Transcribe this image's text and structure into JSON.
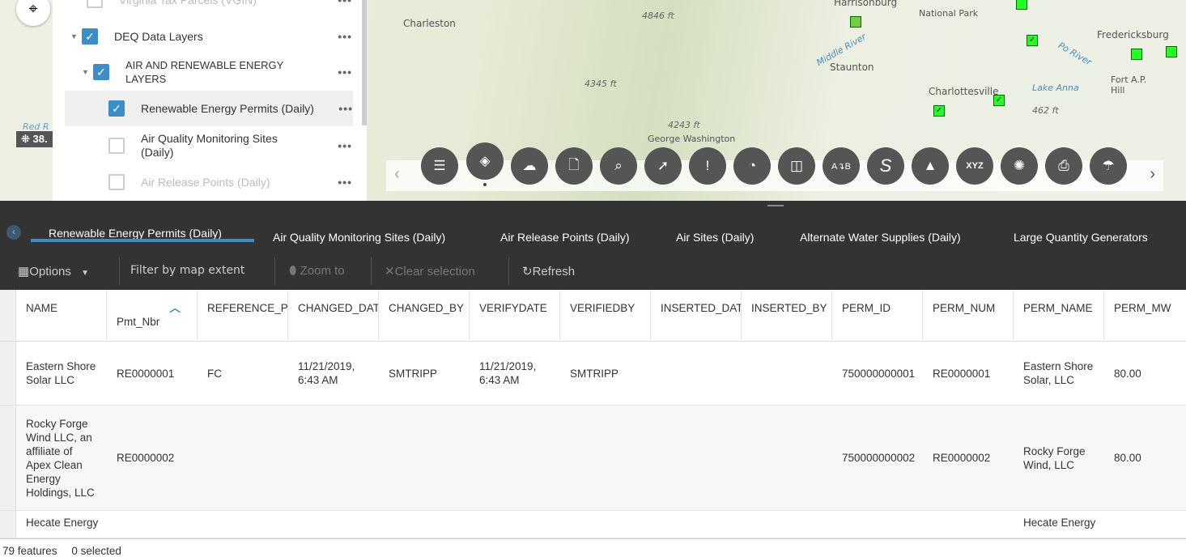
{
  "map": {
    "labels": [
      "Charleston",
      "4846 ft",
      "Harrisonburg",
      "National Park",
      "Fredericksburg",
      "Staunton",
      "4345 ft",
      "Charlottesville",
      "Lake Anna",
      "462 ft",
      "Fort A.P. Hill",
      "4243 ft",
      "George Washington",
      "Red R",
      "Middle River",
      "Po River"
    ],
    "coordinate": "38."
  },
  "layers": {
    "items": [
      {
        "label": "Virginia Tax Parcels (VGIN)",
        "checked": false
      },
      {
        "label": "DEQ Data Layers",
        "checked": true
      },
      {
        "label": "AIR AND RENEWABLE ENERGY LAYERS",
        "checked": true
      },
      {
        "label": "Renewable Energy Permits (Daily)",
        "checked": true
      },
      {
        "label": "Air Quality Monitoring Sites (Daily)",
        "checked": false
      },
      {
        "label": "Air Release Points (Daily)",
        "checked": false
      }
    ],
    "more": "•••"
  },
  "toolbar": {
    "tools": [
      "legend",
      "layer-list",
      "add-data",
      "add-file",
      "query",
      "select",
      "incident",
      "screening",
      "swipe",
      "directions",
      "draw",
      "elevation-profile",
      "coordinate-conversion",
      "analysis",
      "print",
      "weather"
    ]
  },
  "tabs": [
    "Renewable Energy Permits (Daily)",
    "Air Quality Monitoring Sites (Daily)",
    "Air Release Points (Daily)",
    "Air Sites (Daily)",
    "Alternate Water Supplies (Daily)",
    "Large Quantity Generators"
  ],
  "actions": {
    "options": "Options",
    "filter": "Filter by map extent",
    "zoom": "Zoom to",
    "clear": "Clear selection",
    "refresh": "Refresh"
  },
  "table": {
    "columns": [
      "NAME",
      "Pmt_Nbr",
      "REFERENCE_PO",
      "CHANGED_DAT",
      "CHANGED_BY",
      "VERIFYDATE",
      "VERIFIEDBY",
      "INSERTED_DAT",
      "INSERTED_BY",
      "PERM_ID",
      "PERM_NUM",
      "PERM_NAME",
      "PERM_MW"
    ],
    "sorted_column": "Pmt_Nbr",
    "sort": "ascending",
    "rows": [
      [
        "Eastern Shore Solar LLC",
        "RE0000001",
        "FC",
        "11/21/2019, 6:43 AM",
        "SMTRIPP",
        "11/21/2019, 6:43 AM",
        "SMTRIPP",
        "",
        "",
        "750000000001",
        "RE0000001",
        "Eastern Shore Solar, LLC",
        "80.00"
      ],
      [
        "Rocky Forge Wind LLC, an affiliate of Apex Clean Energy Holdings, LLC",
        "RE0000002",
        "",
        "",
        "",
        "",
        "",
        "",
        "",
        "750000000002",
        "RE0000002",
        "Rocky Forge Wind, LLC",
        "80.00"
      ],
      [
        "Hecate Energy",
        "",
        "",
        "",
        "",
        "",
        "",
        "",
        "",
        "",
        "",
        "Hecate Energy",
        ""
      ]
    ]
  },
  "footer": {
    "features": "79 features",
    "selected": "0 selected"
  },
  "colors": {
    "accent": "#3c8ec8",
    "panel": "#333333"
  }
}
